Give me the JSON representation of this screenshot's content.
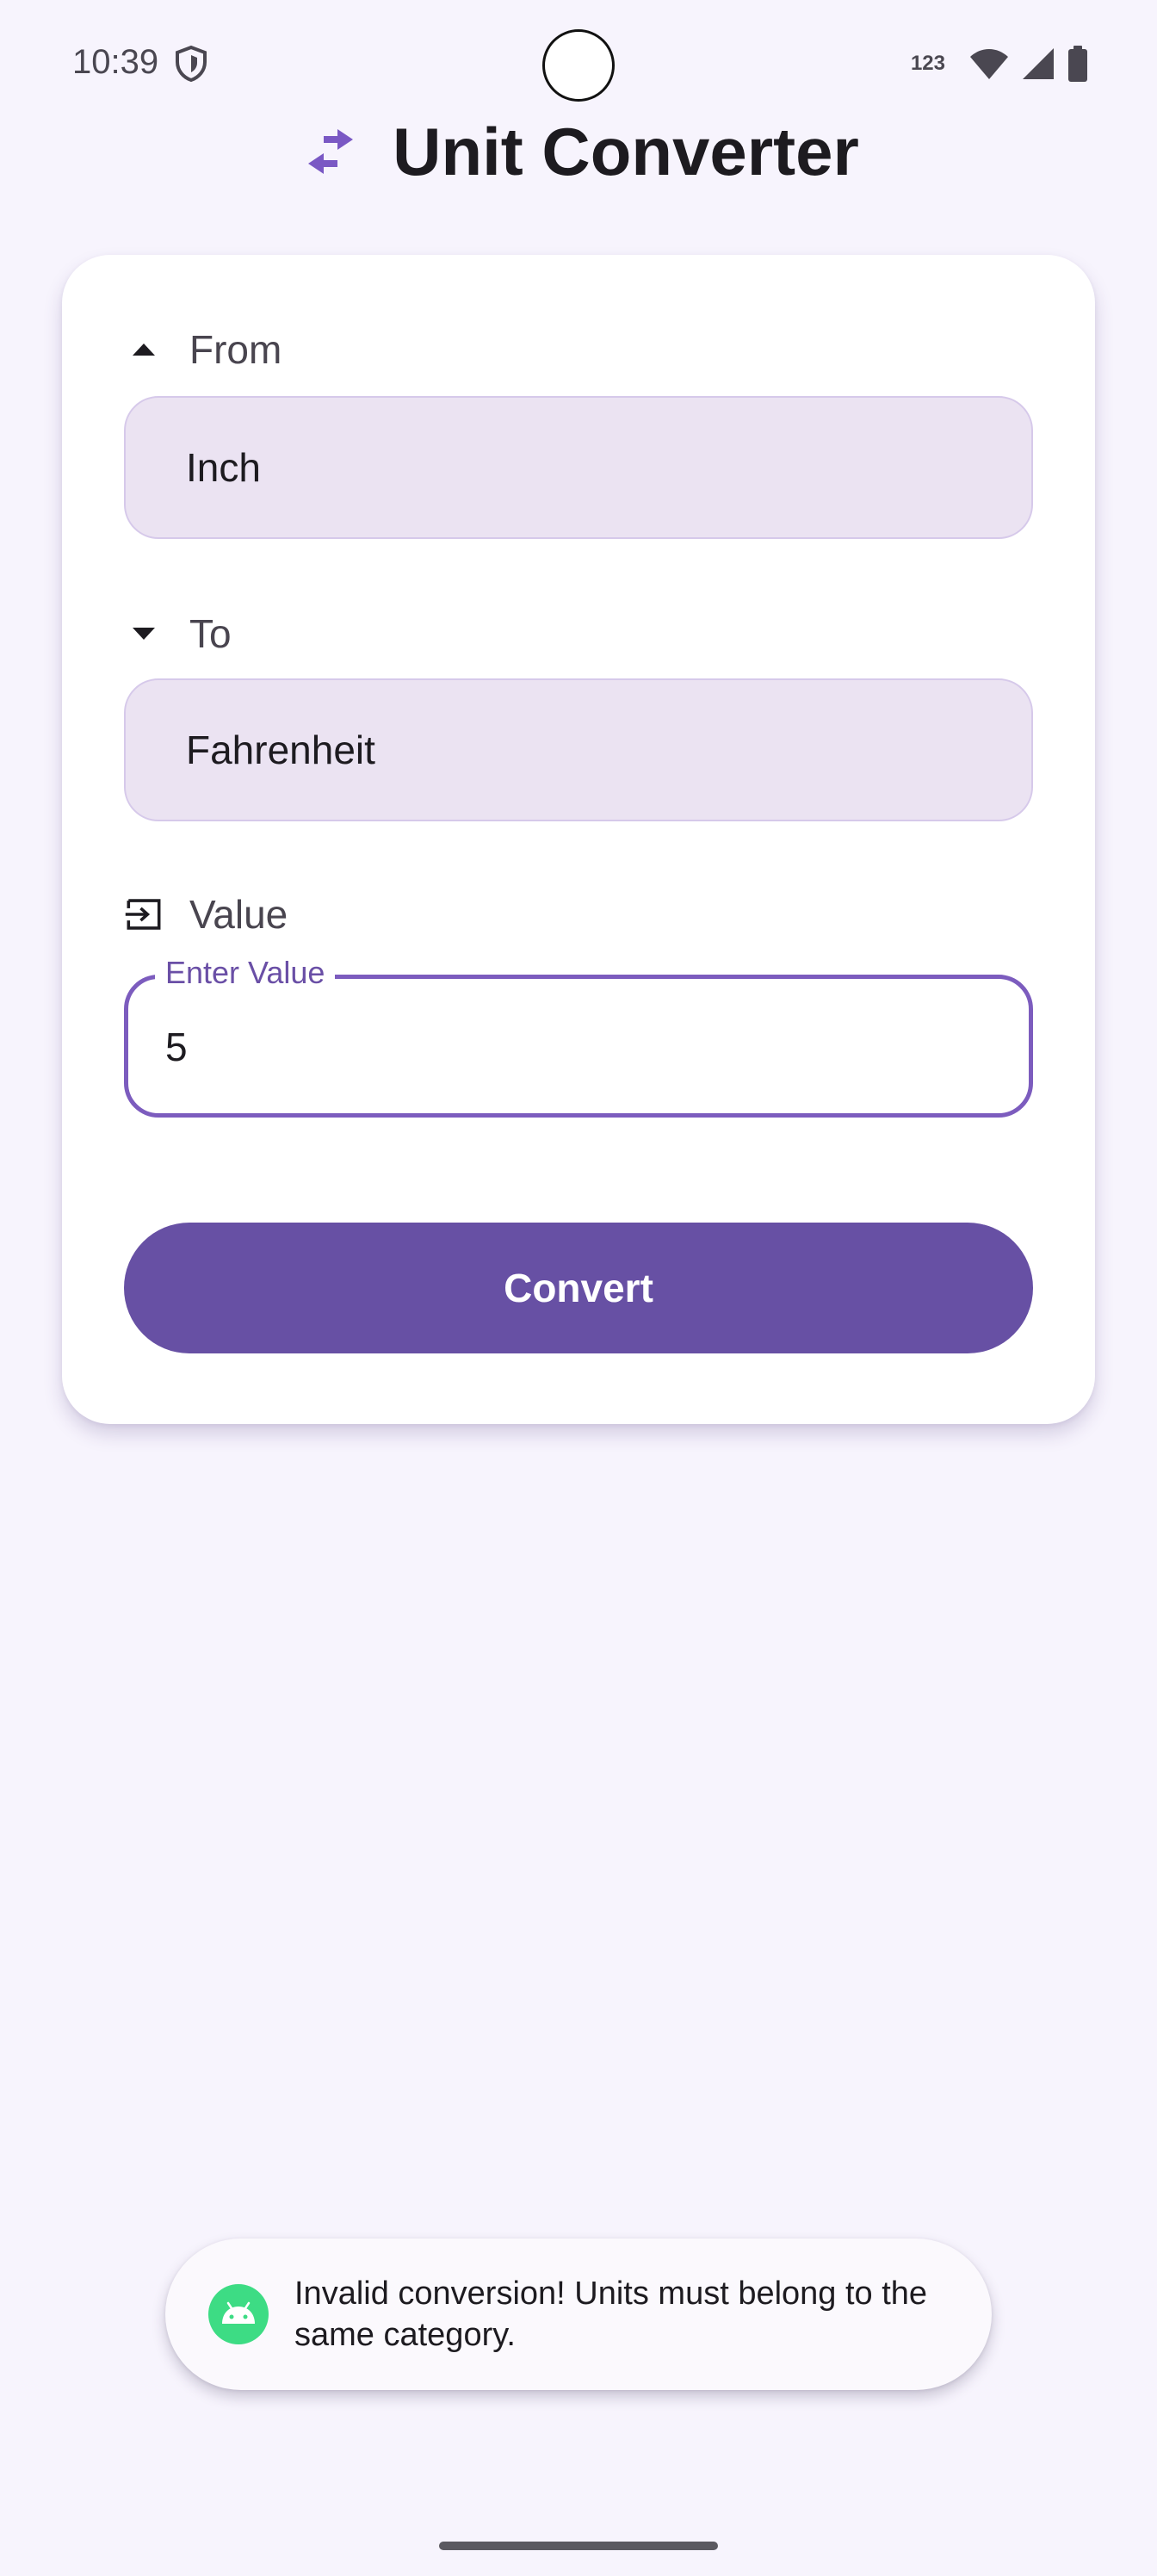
{
  "status_bar": {
    "time": "10:39",
    "network_label": "123",
    "icons": [
      "shield-icon",
      "wifi-icon",
      "signal-icon",
      "battery-icon"
    ]
  },
  "app": {
    "title": "Unit Converter",
    "title_icon": "swap-arrows-icon",
    "accent_color": "#6750a4"
  },
  "form": {
    "from": {
      "label": "From",
      "icon": "arrow-up-icon",
      "value": "Inch"
    },
    "to": {
      "label": "To",
      "icon": "arrow-down-icon",
      "value": "Fahrenheit"
    },
    "value": {
      "label": "Value",
      "icon": "input-icon",
      "field_label": "Enter Value",
      "field_value": "5"
    },
    "convert_label": "Convert"
  },
  "toast": {
    "icon": "android-icon",
    "message": "Invalid conversion! Units must belong to the same category."
  }
}
